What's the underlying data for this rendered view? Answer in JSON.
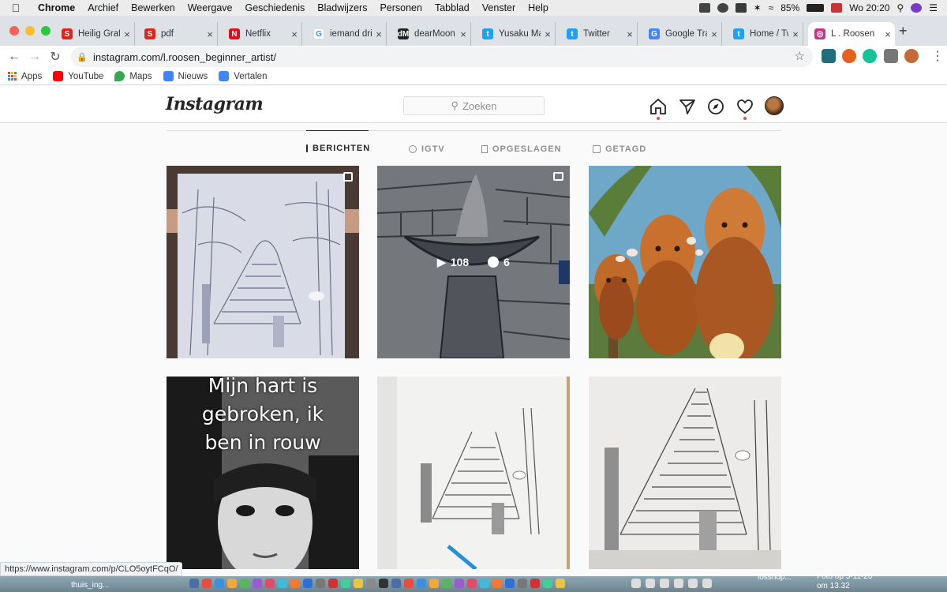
{
  "menubar": {
    "app": "Chrome",
    "items": [
      "Archief",
      "Bewerken",
      "Weergave",
      "Geschiedenis",
      "Bladwijzers",
      "Personen",
      "Tabblad",
      "Venster",
      "Help"
    ],
    "battery": "85%",
    "clock": "Wo 20:20"
  },
  "tabs": [
    {
      "title": "Heilig Grafi",
      "color": "#e2231a",
      "glyph": "S"
    },
    {
      "title": "pdf",
      "color": "#e2231a",
      "glyph": "S"
    },
    {
      "title": "Netflix",
      "color": "#e50914",
      "glyph": "N"
    },
    {
      "title": "iemand dri",
      "color": "#ffffff",
      "glyph": "G"
    },
    {
      "title": "dearMoon",
      "color": "#222222",
      "glyph": "dM"
    },
    {
      "title": "Yusaku Ma",
      "color": "#1da1f2",
      "glyph": "t"
    },
    {
      "title": "Twitter",
      "color": "#1da1f2",
      "glyph": "t"
    },
    {
      "title": "Google Tra",
      "color": "#4285f4",
      "glyph": "G"
    },
    {
      "title": "Home / Tw",
      "color": "#1da1f2",
      "glyph": "t"
    },
    {
      "title": "L . Roosen",
      "color": "#c13584",
      "glyph": "◎"
    }
  ],
  "toolbar": {
    "url": "instagram.com/l.roosen_beginner_artist/"
  },
  "bookmarks": [
    {
      "label": "Apps",
      "color": "#4285f4"
    },
    {
      "label": "YouTube",
      "color": "#ff0000"
    },
    {
      "label": "Maps",
      "color": "#34a853"
    },
    {
      "label": "Nieuws",
      "color": "#4285f4"
    },
    {
      "label": "Vertalen",
      "color": "#4285f4"
    }
  ],
  "instagram": {
    "logo": "Instagram",
    "search_placeholder": "Zoeken",
    "tabs": [
      "BERICHTEN",
      "IGTV",
      "OPGESLAGEN",
      "GETAGD"
    ],
    "posts": [
      {
        "kind": "drawing-stairs-held"
      },
      {
        "kind": "drawing-bowl",
        "views": "108",
        "comments": "6"
      },
      {
        "kind": "painting-faces"
      },
      {
        "kind": "photo-text",
        "text_lines": [
          "Mijn hart is",
          "gebroken, ik",
          "ben in rouw"
        ]
      },
      {
        "kind": "drawing-stairs-table"
      },
      {
        "kind": "drawing-stairs-flat"
      }
    ]
  },
  "status_url": "https://www.instagram.com/p/CLO5oytFCqO/",
  "dock": {
    "left_label": "thuis_ing...",
    "right_label_1": "Foto op 5-11-20",
    "right_label_2": "om 13.32",
    "mid_label": "losshop..."
  }
}
